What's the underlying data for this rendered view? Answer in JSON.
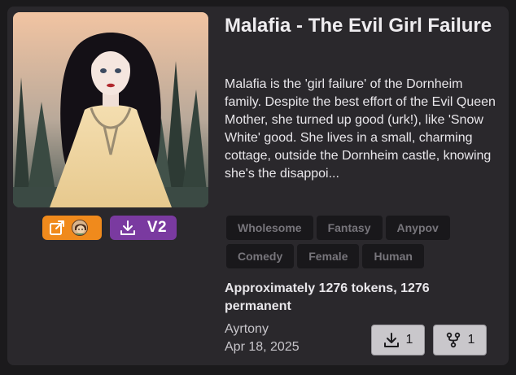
{
  "card": {
    "title": "Malafia - The Evil Girl Failure",
    "description": "Malafia is the 'girl failure' of the Dornheim family. Despite the best effort of the Evil Queen Mother, she turned up good (urk!), like 'Snow White' good. She lives in a small, charming cottage, outside the Dornheim castle, knowing she's the disappoi...",
    "version_label": "V2",
    "tags": [
      "Wholesome",
      "Fantasy",
      "Anypov",
      "Comedy",
      "Female",
      "Human"
    ],
    "token_info": "Approximately 1276 tokens, 1276 permanent",
    "author": "Ayrtony",
    "date": "Apr 18, 2025",
    "download_count": "1",
    "fork_count": "1"
  },
  "icons": {
    "external_link": "external-link-icon",
    "download": "download-icon",
    "fork": "fork-icon"
  },
  "colors": {
    "background": "#1b1a1c",
    "card": "#2a282c",
    "orange_badge": "#f08a1c",
    "purple_badge": "#7a3aa0",
    "tag_bg": "#19181b",
    "tag_text": "#77757b",
    "button_bg": "#c9c7cb"
  }
}
